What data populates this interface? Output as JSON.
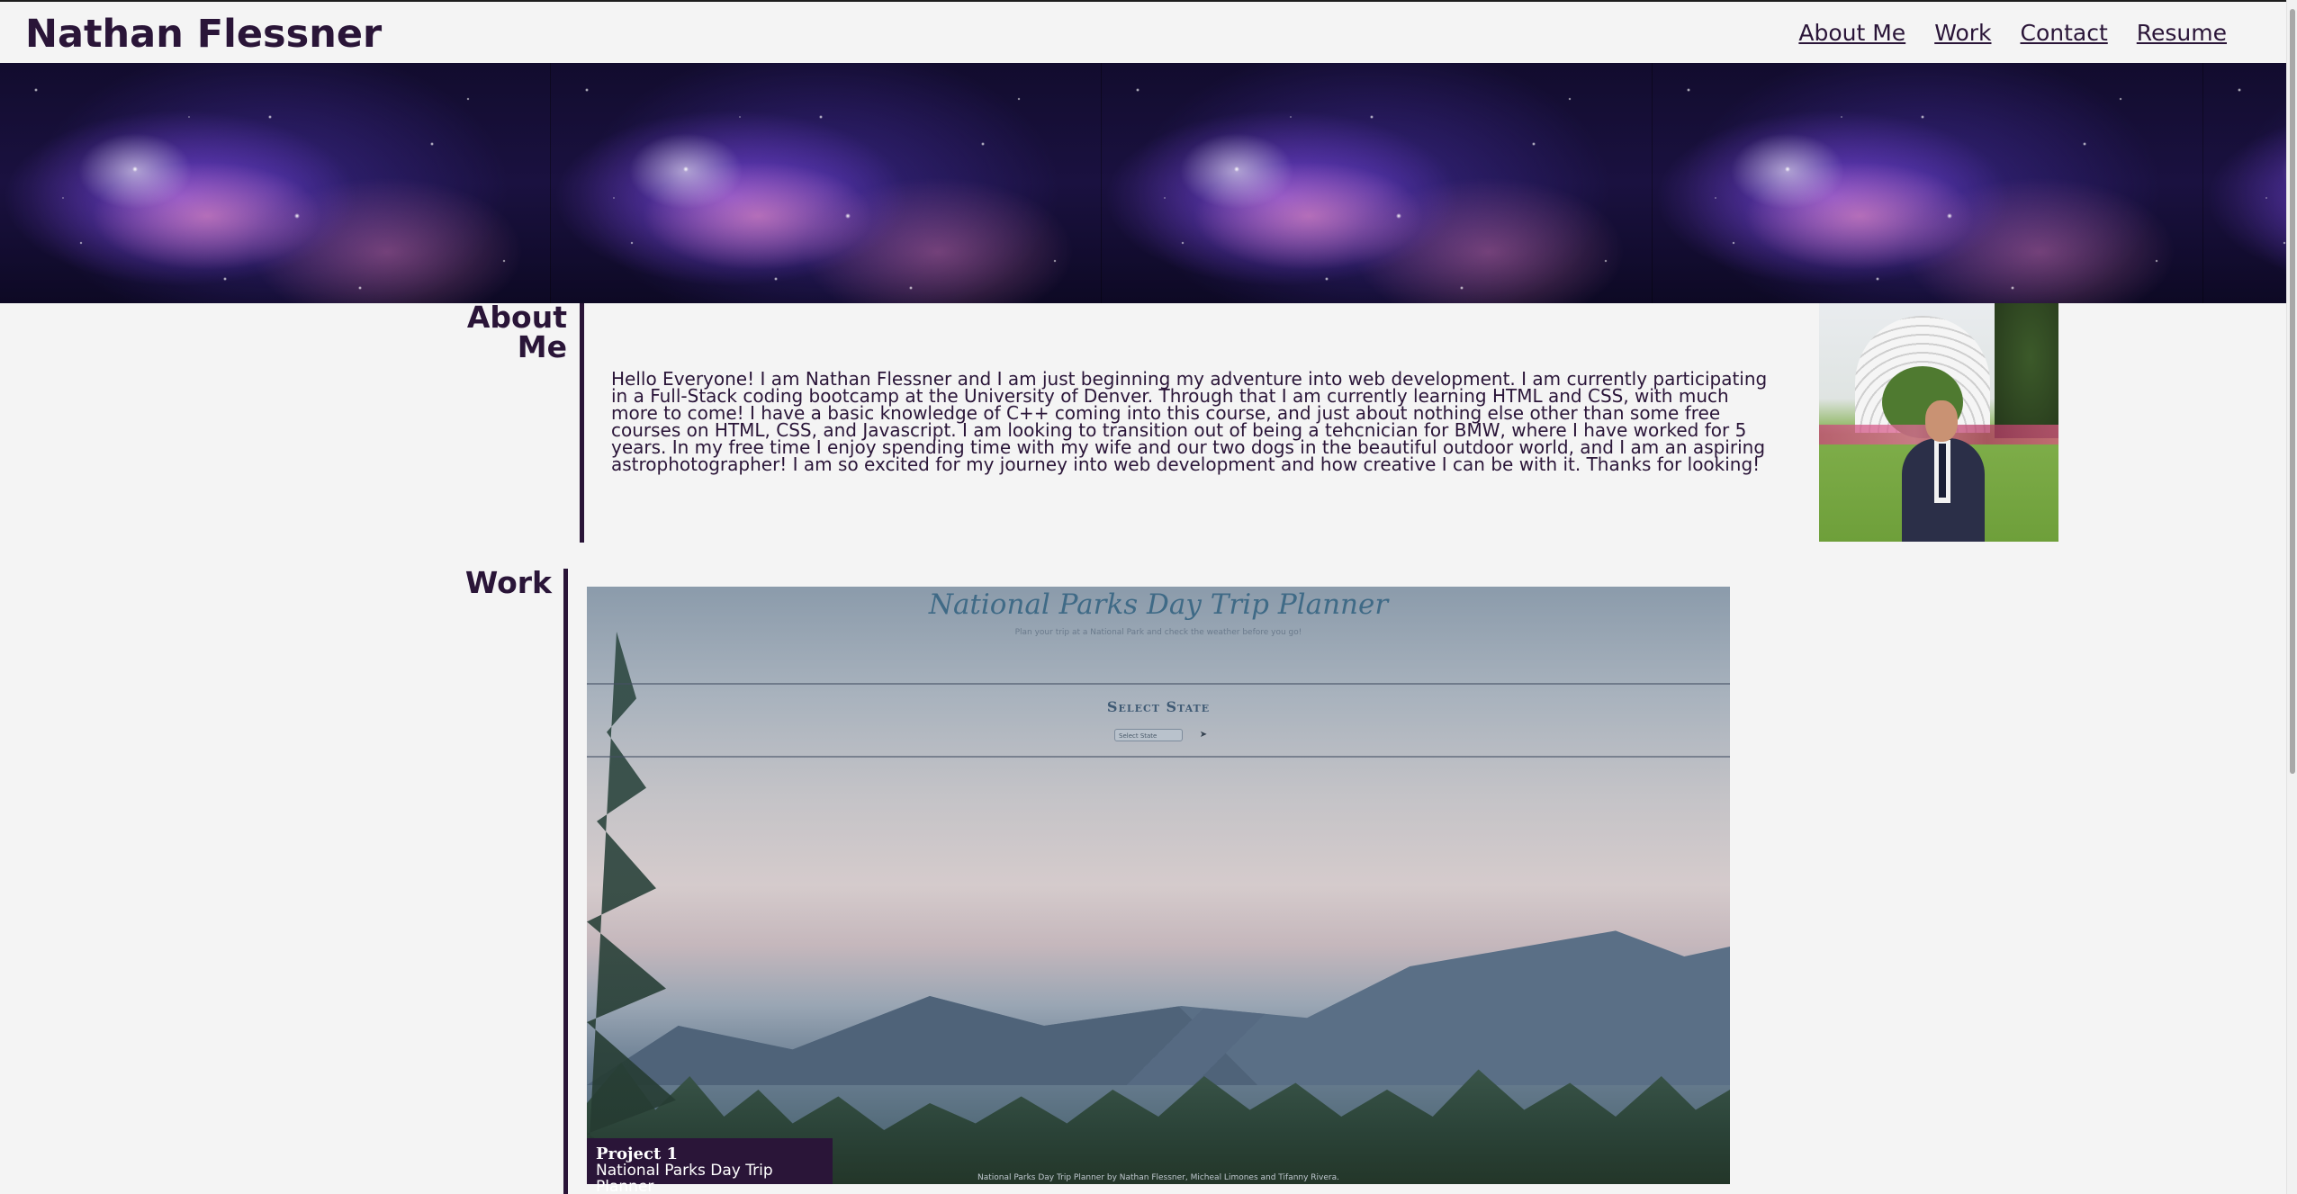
{
  "header": {
    "title": "Nathan Flessner",
    "nav": [
      {
        "label": "About Me"
      },
      {
        "label": "Work"
      },
      {
        "label": "Contact"
      },
      {
        "label": "Resume"
      }
    ]
  },
  "hero": {
    "image": "galaxy-banner"
  },
  "about": {
    "heading": "About Me",
    "text": "Hello Everyone! I am Nathan Flessner and I am just beginning my adventure into web development. I am currently participating in a Full-Stack coding bootcamp at the University of Denver. Through that I am currently learning HTML and CSS, with much more to come! I have a basic knowledge of C++ coming into this course, and just about nothing else other than some free courses on HTML, CSS, and Javascript. I am looking to transition out of being a tehcnician for BMW, where I have worked for 5 years. In my free time I enjoy spending time with my wife and our two dogs in the beautiful outdoor world, and I am an aspiring astrophotographer! I am so excited for my journey into web development and how creative I can be with it. Thanks for looking!",
    "photo": "profile-photo"
  },
  "work": {
    "heading": "Work",
    "projects": [
      {
        "number_label": "Project 1",
        "name": "National Parks Day Trip Planner",
        "screenshot": {
          "title": "National Parks Day Trip Planner",
          "subtitle": "Plan your trip at a National Park and check the weather before you go!",
          "select_heading": "Select State",
          "select_placeholder": "Select State",
          "footer": "National Parks Day Trip Planner by Nathan Flessner, Micheal Limones and Tifanny Rivera."
        }
      }
    ]
  },
  "colors": {
    "primary": "#2a1538",
    "background": "#f4f4f4"
  }
}
